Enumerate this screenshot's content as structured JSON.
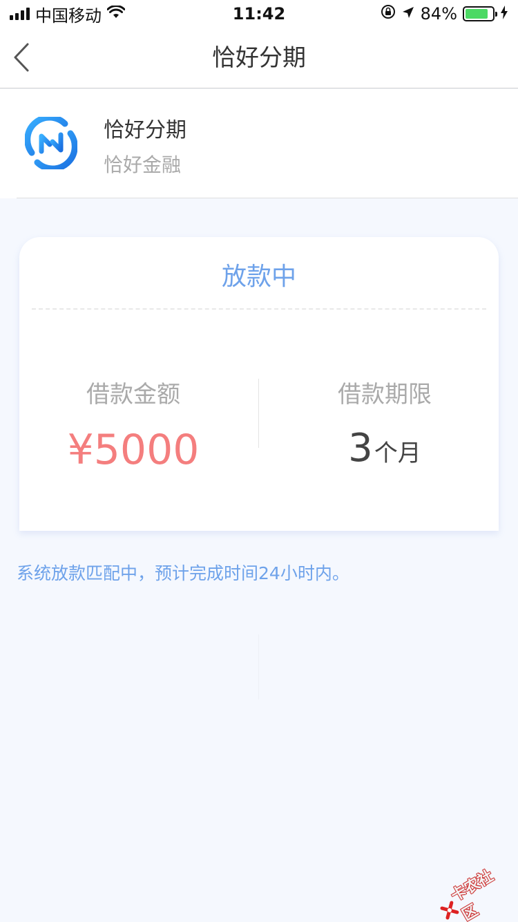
{
  "status_bar": {
    "carrier": "中国移动",
    "time": "11:42",
    "battery": "84%",
    "battery_level": 0.84
  },
  "nav": {
    "title": "恰好分期"
  },
  "product": {
    "name": "恰好分期",
    "company": "恰好金融",
    "logo_color": "#2f8ff0"
  },
  "loan_card": {
    "status": "放款中",
    "amount_label": "借款金额",
    "amount_value": "¥5000",
    "term_label": "借款期限",
    "term_value": "3",
    "term_unit": "个月"
  },
  "notice": "系统放款匹配中，预计完成时间24小时内。",
  "watermark": {
    "text": "卡农社区"
  },
  "colors": {
    "accent_blue": "#6ea2ea",
    "amount_red": "#f47e7e",
    "background": "#f5f8fe"
  }
}
